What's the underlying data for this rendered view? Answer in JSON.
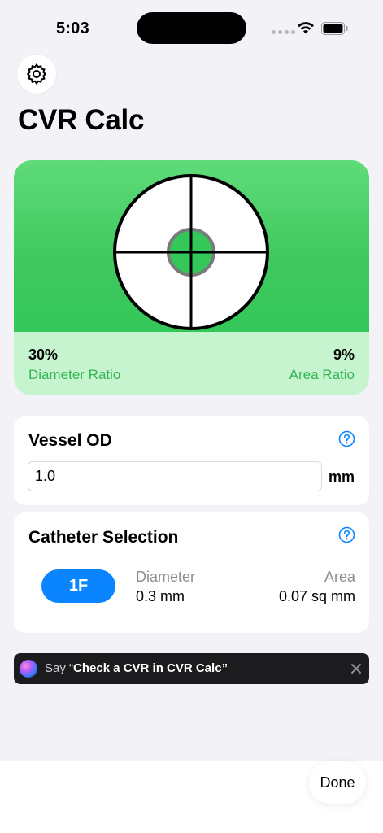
{
  "status_bar": {
    "time": "5:03"
  },
  "app": {
    "title": "CVR Calc"
  },
  "ratio_card": {
    "diameter_ratio_value": "30%",
    "diameter_ratio_label": "Diameter Ratio",
    "area_ratio_value": "9%",
    "area_ratio_label": "Area Ratio"
  },
  "vessel": {
    "title": "Vessel OD",
    "value": "1.0",
    "unit": "mm"
  },
  "catheter": {
    "title": "Catheter Selection",
    "size": "1F",
    "diameter_label": "Diameter",
    "diameter_value": "0.3 mm",
    "area_label": "Area",
    "area_value": "0.07 sq mm"
  },
  "siri": {
    "prefix": "Say “",
    "phrase": "Check a CVR in CVR Calc",
    "suffix": "”"
  },
  "toolbar": {
    "done_label": "Done"
  },
  "colors": {
    "accent_green": "#34c759",
    "accent_blue": "#0a84ff",
    "background": "#f2f2f7"
  },
  "icons": [
    "gear-icon",
    "question-circle-icon",
    "wifi-icon",
    "battery-icon",
    "close-icon",
    "siri-orb-icon"
  ]
}
